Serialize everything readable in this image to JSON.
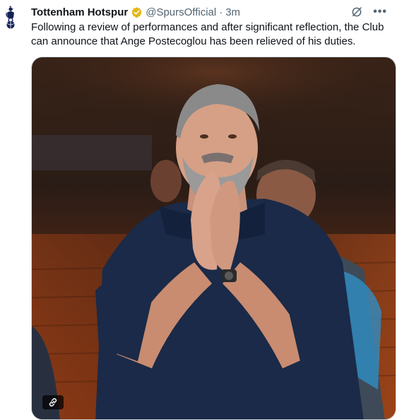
{
  "tweet": {
    "author_name": "Tottenham Hotspur",
    "handle": "@SpursOfficial",
    "separator": "·",
    "time": "3m",
    "more_label": "•••",
    "text": "Following a review of performances and after significant reflection, the Club can announce that Ange Postecoglou has been relieved of his duties."
  },
  "icons": {
    "avatar": "spurs-crest-icon",
    "verified": "verified-gold-badge-icon",
    "grok": "grok-icon",
    "more": "more-icon",
    "link": "link-icon"
  },
  "colors": {
    "text": "#0f1419",
    "secondary": "#536471",
    "verified_gold": "#e2b719",
    "media_border": "#cfd9de"
  }
}
